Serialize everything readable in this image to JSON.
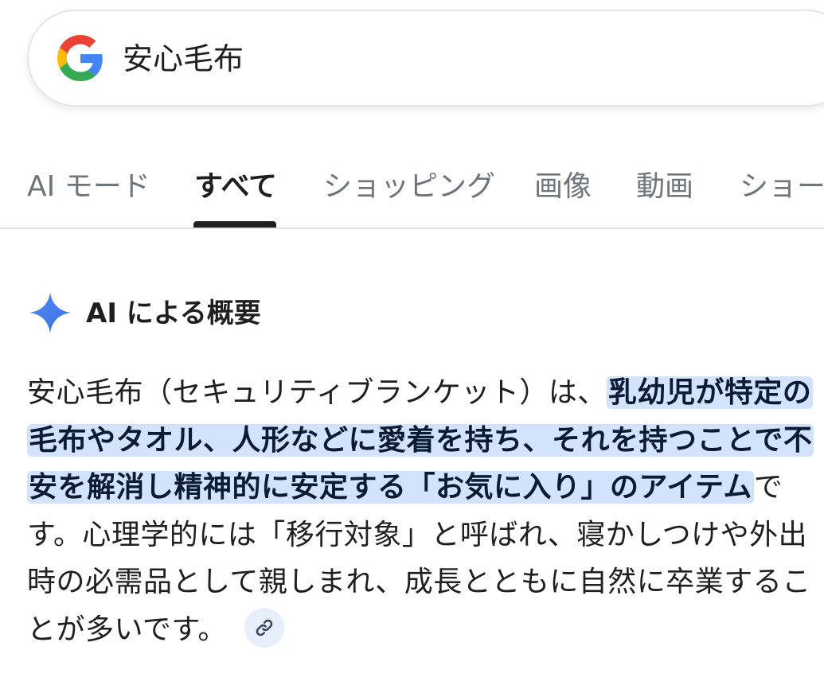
{
  "search": {
    "query": "安心毛布",
    "logo_icon": "google-g-icon"
  },
  "tabs": [
    {
      "label": "AI モード",
      "active": false
    },
    {
      "label": "すべて",
      "active": true
    },
    {
      "label": "ショッピング",
      "active": false
    },
    {
      "label": "画像",
      "active": false
    },
    {
      "label": "動画",
      "active": false
    },
    {
      "label": "ショー",
      "active": false
    }
  ],
  "ai_overview": {
    "icon": "sparkle-icon",
    "title": "AI による概要",
    "body_intro": "安心毛布（セキュリティブランケット）は、",
    "body_highlight": "乳幼児が特定の毛布やタオル、人形などに愛着を持ち、それを持つことで不安を解消し精神的に安定する「お気に入り」のアイテム",
    "body_rest": "です。心理学的には「移行対象」と呼ばれ、寝かしつけや外出時の必需品として親しまれ、成長とともに自然に卒業することが多いです。",
    "link_icon": "link-icon"
  },
  "colors": {
    "highlight_bg": "#d3e3fd",
    "sparkle_blue": "#4285f4",
    "active_tab_indicator": "#1f1f1f",
    "inactive_tab_text": "#70757a"
  }
}
